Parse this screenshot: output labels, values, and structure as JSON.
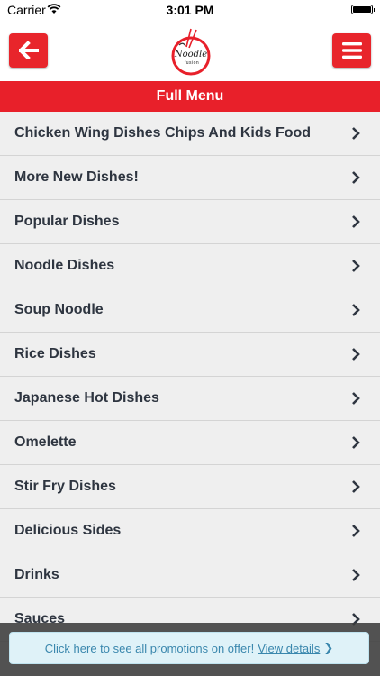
{
  "status": {
    "carrier": "Carrier",
    "time": "3:01 PM"
  },
  "header": {
    "logo_text": "Noodle",
    "logo_subtext": "fusion"
  },
  "title": "Full Menu",
  "menu": [
    {
      "label": "Chicken Wing Dishes Chips And Kids Food"
    },
    {
      "label": "More New Dishes!"
    },
    {
      "label": "Popular Dishes"
    },
    {
      "label": "Noodle Dishes"
    },
    {
      "label": "Soup Noodle"
    },
    {
      "label": "Rice Dishes"
    },
    {
      "label": "Japanese Hot Dishes"
    },
    {
      "label": "Omelette"
    },
    {
      "label": "Stir Fry Dishes"
    },
    {
      "label": "Delicious Sides"
    },
    {
      "label": "Drinks"
    },
    {
      "label": "Sauces"
    }
  ],
  "promo": {
    "text": "Click here to see all promotions on offer!",
    "link": "View details",
    "arrow": "❯"
  },
  "colors": {
    "brand_red": "#e8202a",
    "promo_text": "#3a87ad",
    "item_text": "#2e3540"
  },
  "icons": {
    "back": "arrow-left-icon",
    "menu": "hamburger-icon",
    "chevron": "chevron-right-icon"
  }
}
